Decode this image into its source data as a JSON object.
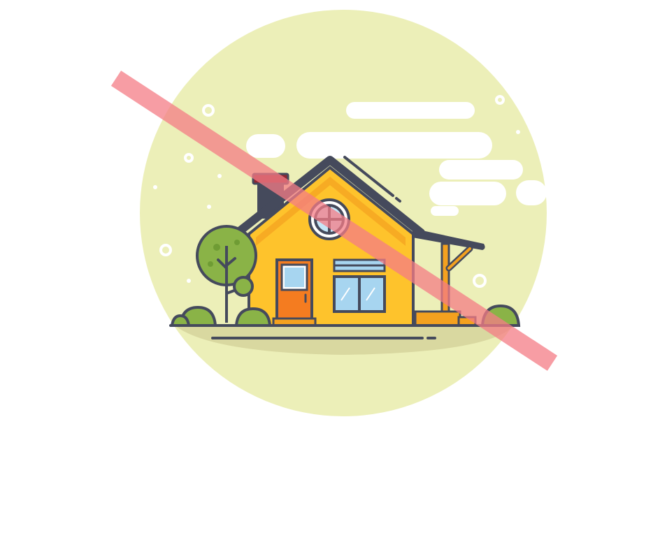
{
  "illustration": {
    "subject": "house-icon",
    "overlay": "prohibited-slash-icon"
  },
  "colors": {
    "background": "#ffffff",
    "circle": "#ecefb8",
    "ground": "#d9d8a0",
    "outline": "#454a5c",
    "house_wall": "#fec32c",
    "house_wall_shade": "#f4a11f",
    "roof_trim": "#454a5c",
    "chimney_cap": "#8e2631",
    "chimney": "#454a5c",
    "door": "#f47c20",
    "window_glass": "#a7d5f0",
    "round_window_glass": "#c5e6f7",
    "porch_post": "#f4a11f",
    "tree_green": "#8ab347",
    "tree_dark_green": "#6f9c34",
    "cloud": "#ffffff",
    "slash": "#f47c86"
  }
}
